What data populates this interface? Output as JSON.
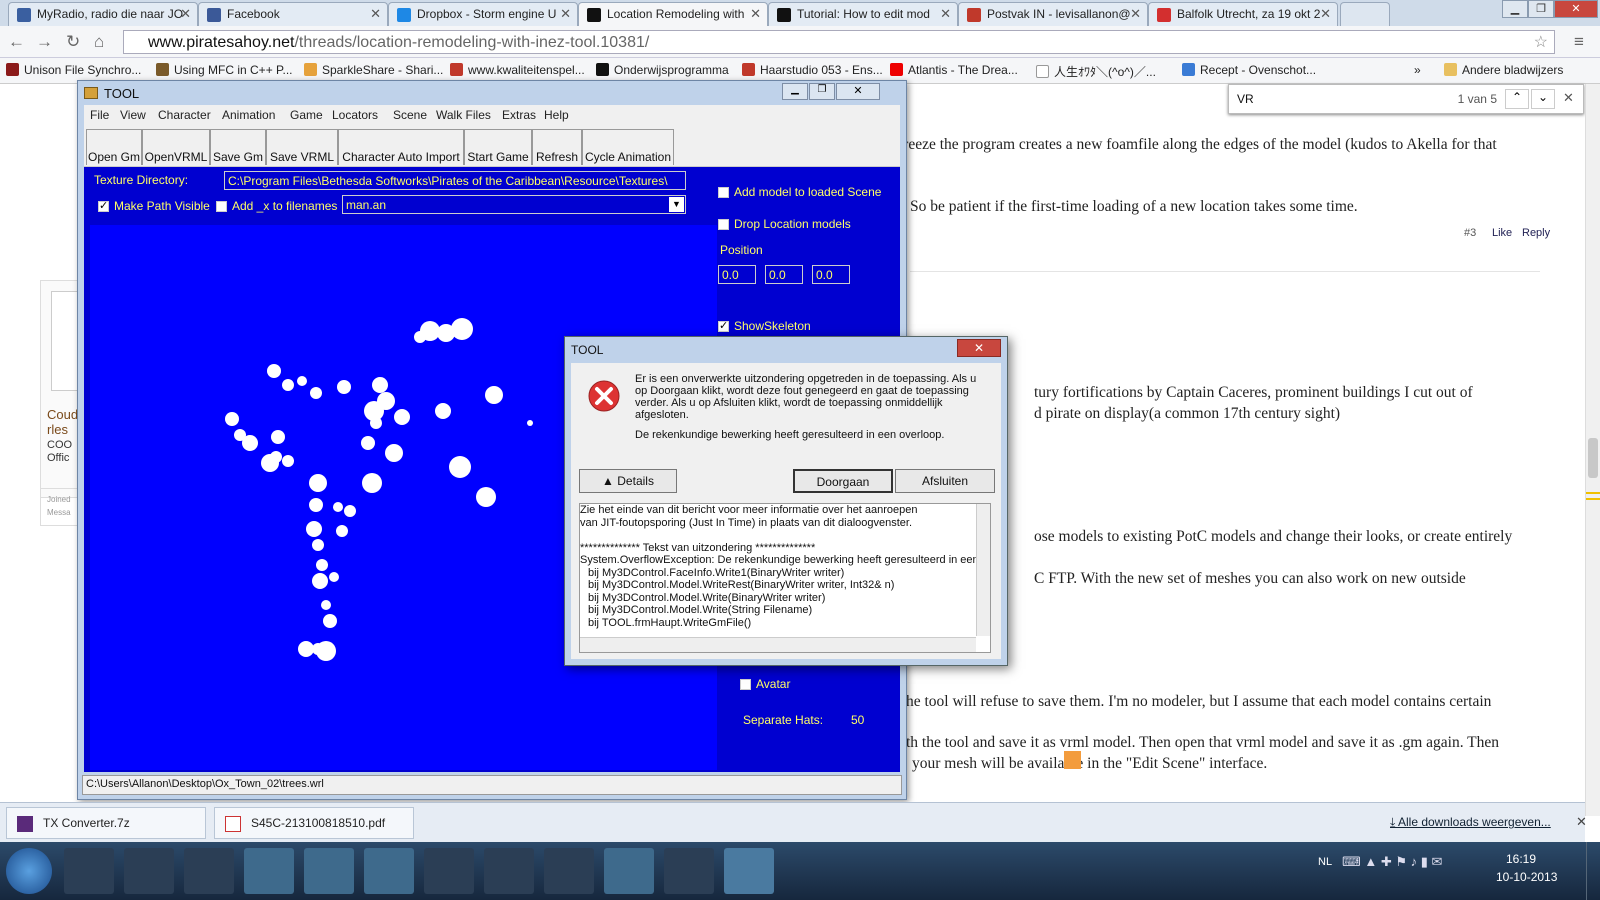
{
  "browser": {
    "tabs": [
      {
        "label": "MyRadio, radio die naar JO",
        "color": "#3a5fa0"
      },
      {
        "label": "Facebook",
        "color": "#3b5998"
      },
      {
        "label": "Dropbox - Storm engine U",
        "color": "#1e88e5"
      },
      {
        "label": "Location Remodeling with",
        "color": "#111111"
      },
      {
        "label": "Tutorial: How to edit mod",
        "color": "#111111"
      },
      {
        "label": "Postvak IN - levisallanon@",
        "color": "#c0392b"
      },
      {
        "label": "Balfolk Utrecht, za 19 okt 2",
        "color": "#d32f2f"
      }
    ],
    "url_domain": "www.piratesahoy.net",
    "url_path": "/threads/location-remodeling-with-inez-tool.10381/",
    "bookmarks": [
      "Unison File Synchro...",
      "Using MFC in C++ P...",
      "SparkleShare - Shari...",
      "www.kwaliteitenspel...",
      "Onderwijsprogramma",
      "Haarstudio 053 - Ens...",
      "Atlantis - The Drea...",
      "人生ｵﾜﾀ＼(^o^)／...",
      "Recept - Ovenschot..."
    ],
    "bookmarks_more": "»",
    "other_bookmarks": "Andere bladwijzers",
    "find": {
      "query": "VR",
      "count": "1 van 5"
    }
  },
  "page": {
    "lines": [
      "freeze the program creates a new foamfile along the edges of the model (kudos to Akella for that",
      "So be patient if the first-time loading of a new location takes some time.",
      "tury fortifications by Captain Caceres, prominent buildings I cut out of",
      "d pirate on display(a common 17th century sight)",
      "ose models to existing PotC models and change their looks, or create entirely",
      "C FTP. With the new set of meshes you can also work on new outside",
      "he tool will refuse to save them. I'm no modeler, but I assume that each model contains certain",
      "th the tool and save it as vrml model. Then open that vrml model and save it as .gm again. Then",
      "your mesh will be available in the \"Edit Scene\" interface."
    ],
    "post_num": "#3",
    "like": "Like",
    "reply": "Reply",
    "sidebar_card": [
      "Coud",
      "rles",
      "COO",
      "Offic"
    ],
    "joined": "Joined",
    "messages": "Messa"
  },
  "tool": {
    "title": "TOOL",
    "menu": [
      "File",
      "View",
      "Character",
      "Animation",
      "Game",
      "Locators",
      "Scene",
      "Walk Files",
      "Extras",
      "Help"
    ],
    "toolbar": [
      "Open Gm",
      "OpenVRML",
      "Save Gm",
      "Save VRML",
      "Character Auto Import",
      "Start Game",
      "Refresh",
      "Cycle Animation"
    ],
    "texture_label": "Texture Directory:",
    "texture_path": "C:\\Program Files\\Bethesda Softworks\\Pirates of the Caribbean\\Resource\\Textures\\",
    "make_path_visible": "Make Path Visible",
    "add_x": "Add _x to filenames",
    "animation_file": "man.an",
    "add_model": "Add model to loaded Scene",
    "drop_location": "Drop Location models",
    "position_label": "Position",
    "position": [
      "0.0",
      "0.0",
      "0.0"
    ],
    "show_skeleton": "ShowSkeleton",
    "avatar": "Avatar",
    "separate_hats_label": "Separate Hats:",
    "separate_hats_value": "50",
    "status_path": "C:\\Users\\Allanon\\Desktop\\Ox_Town_02\\trees.wrl"
  },
  "dialog": {
    "title": "TOOL",
    "message": [
      "Er is een onverwerkte uitzondering opgetreden in de toepassing. Als u",
      "op Doorgaan klikt, wordt deze fout genegeerd en gaat de toepassing",
      "verder. Als u op Afsluiten klikt, wordt de toepassing onmiddellijk",
      "afgesloten."
    ],
    "message2": "De rekenkundige bewerking heeft geresulteerd in een overloop.",
    "details": "Details",
    "continue": "Doorgaan",
    "quit": "Afsluiten",
    "detail_lines": [
      "Zie het einde van dit bericht voor meer informatie over het aanroepen",
      "van JIT-foutopsporing (Just In Time) in plaats van dit dialoogvenster.",
      "",
      "************** Tekst van uitzondering **************",
      "System.OverflowException: De rekenkundige bewerking heeft geresulteerd in een ov",
      "   bij My3DControl.FaceInfo.Write1(BinaryWriter writer)",
      "   bij My3DControl.Model.WriteRest(BinaryWriter writer, Int32& n)",
      "   bij My3DControl.Model.Write(BinaryWriter writer)",
      "   bij My3DControl.Model.Write(String Filename)",
      "   bij TOOL.frmHaupt.WriteGmFile()"
    ]
  },
  "downloads": {
    "items": [
      "TX Converter.7z",
      "S45C-213100818510.pdf"
    ],
    "show_all": "Alle downloads weergeven..."
  },
  "taskbar": {
    "lang": "NL",
    "time": "16:19",
    "date": "10-10-2013"
  }
}
